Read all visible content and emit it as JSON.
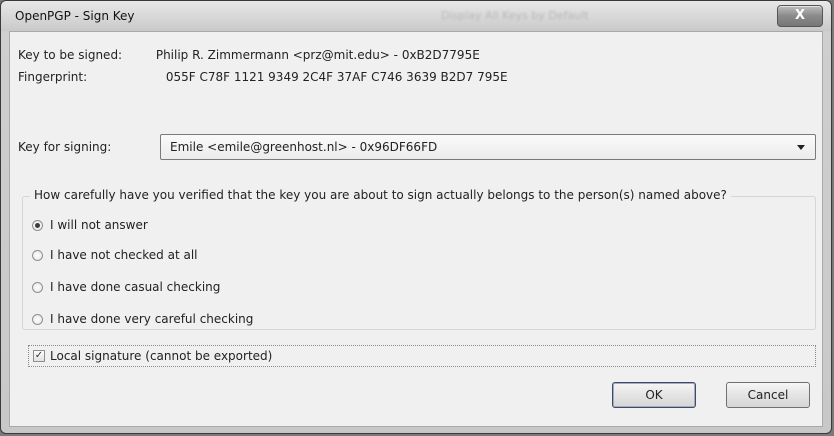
{
  "window": {
    "title": "OpenPGP - Sign Key",
    "background_title": "Display All Keys by Default",
    "close_glyph": "X"
  },
  "key_info": {
    "signed_label": "Key to be signed:",
    "signed_value": "Philip R. Zimmermann <prz@mit.edu> - 0xB2D7795E",
    "fingerprint_label": "Fingerprint:",
    "fingerprint_value": "055F C78F 1121 9349 2C4F 37AF C746 3639 B2D7 795E"
  },
  "signing": {
    "label": "Key for signing:",
    "selected": "Emile <emile@greenhost.nl> - 0x96DF66FD"
  },
  "verification": {
    "question": "How carefully have you verified that the key you are about to sign actually belongs to the person(s) named above?",
    "options": [
      {
        "label": "I will not answer",
        "checked": true
      },
      {
        "label": "I have not checked at all",
        "checked": false
      },
      {
        "label": "I have done casual checking",
        "checked": false
      },
      {
        "label": "I have done very careful checking",
        "checked": false
      }
    ]
  },
  "local_signature": {
    "label": "Local signature (cannot be exported)",
    "checked": true,
    "check_glyph": "✓"
  },
  "buttons": {
    "ok": "OK",
    "cancel": "Cancel"
  }
}
